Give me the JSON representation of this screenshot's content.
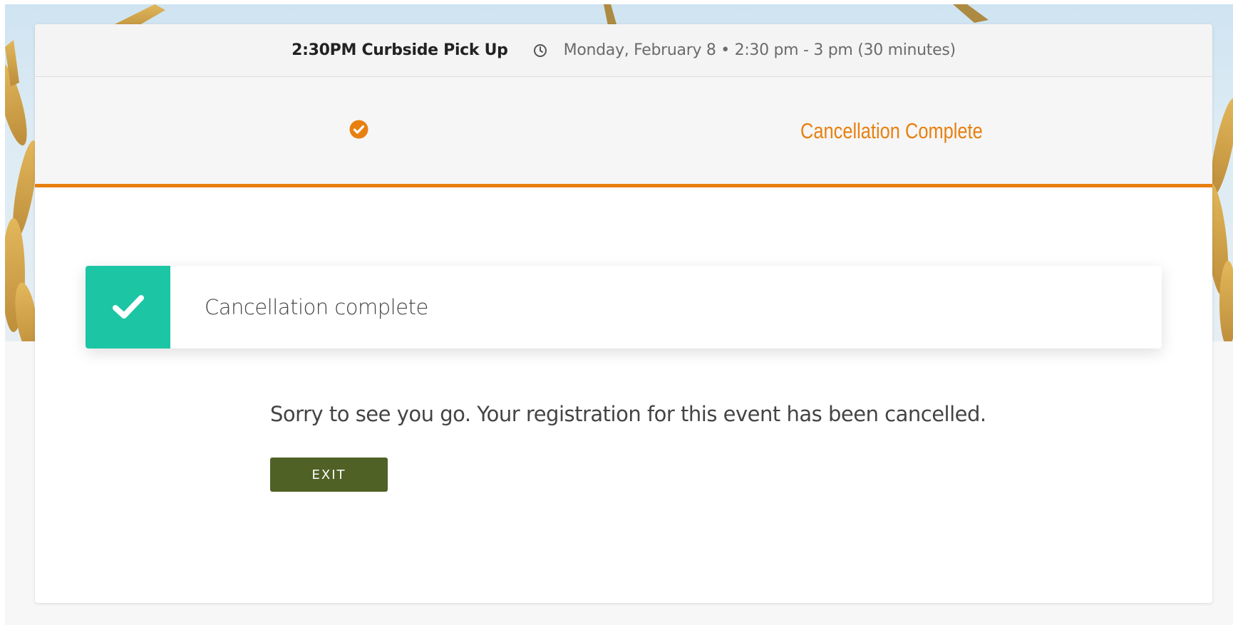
{
  "event": {
    "title": "2:30PM Curbside Pick Up",
    "clock_icon": "clock-icon",
    "datetime": "Monday, February 8 • 2:30 pm - 3 pm (30 minutes)"
  },
  "steps": {
    "check_icon": "check-circle-icon",
    "current_label": "Cancellation Complete"
  },
  "alert": {
    "icon": "checkmark-icon",
    "text": "Cancellation complete"
  },
  "message": "Sorry to see you go. Your registration for this event has been cancelled.",
  "exit_button": "EXIT",
  "colors": {
    "accent": "#e88010",
    "success": "#1cc6a4",
    "button": "#4f6125"
  }
}
